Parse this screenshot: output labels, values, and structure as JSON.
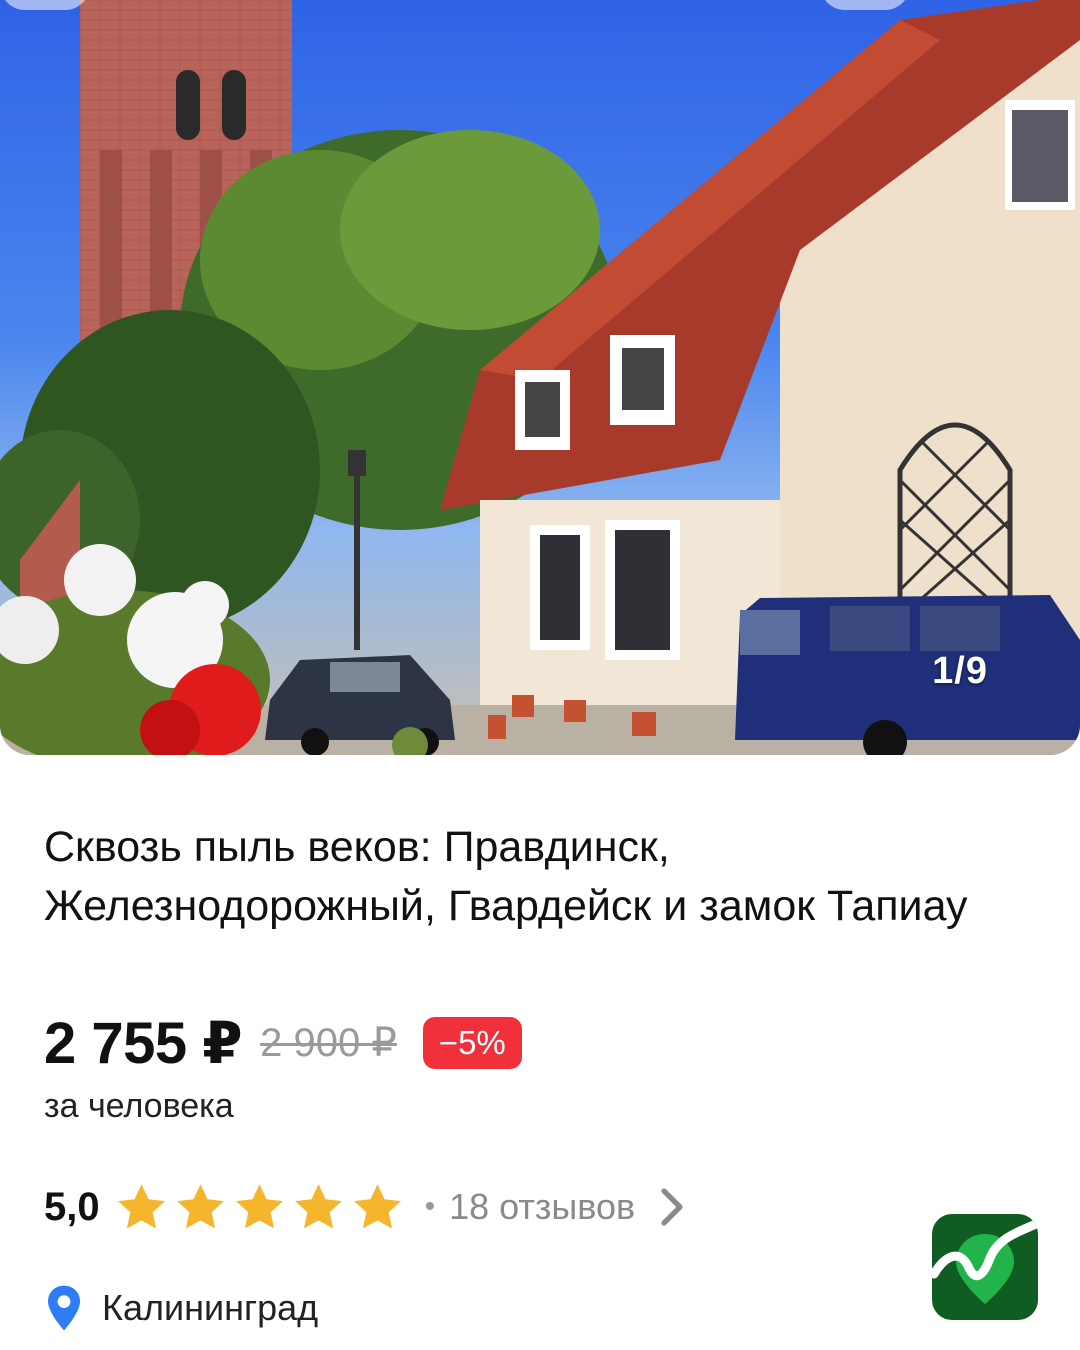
{
  "gallery": {
    "counter": "1/9"
  },
  "tour": {
    "title": "Сквозь пыль веков: Правдинск, Железнодорожный, Гвардейск и замок Тапиау",
    "price_current": "2 755 ₽",
    "price_old": "2 900 ₽",
    "discount": "−5%",
    "price_unit": "за человека",
    "rating": "5,0",
    "stars": 5,
    "reviews": "18 отзывов",
    "city": "Калининград"
  },
  "colors": {
    "star": "#f5b52c",
    "discount_bg": "#f0303b",
    "pin": "#2e7df6",
    "logo_bg": "#0f5d23"
  },
  "icons": [
    "star-icon",
    "chevron-right-icon",
    "location-pin-icon",
    "app-logo"
  ]
}
